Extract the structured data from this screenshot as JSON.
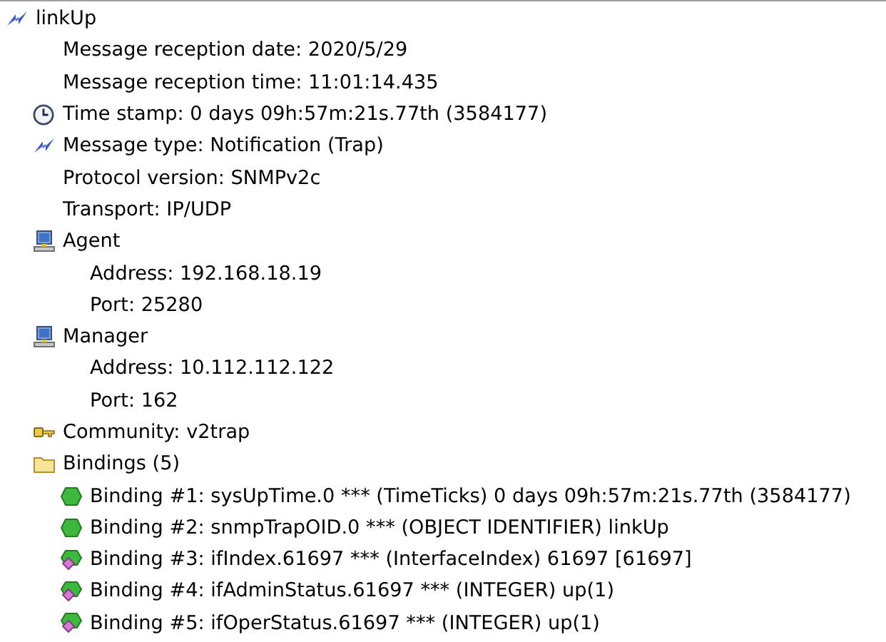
{
  "tree": [
    {
      "label": "linkUp",
      "kind": "trap",
      "children": [
        {
          "label": "Message reception date: 2020/5/29",
          "kind": "plain"
        },
        {
          "label": "Message reception time: 11:01:14.435",
          "kind": "plain"
        },
        {
          "label": "Time stamp: 0 days 09h:57m:21s.77th (3584177)",
          "kind": "time"
        },
        {
          "label": "Message type: Notification (Trap)",
          "kind": "trap"
        },
        {
          "label": "Protocol version: SNMPv2c",
          "kind": "plain"
        },
        {
          "label": "Transport: IP/UDP",
          "kind": "plain"
        },
        {
          "label": "Agent",
          "kind": "host",
          "children": [
            {
              "label": "Address: 192.168.18.19",
              "kind": "plain"
            },
            {
              "label": "Port: 25280",
              "kind": "plain"
            }
          ]
        },
        {
          "label": "Manager",
          "kind": "host",
          "children": [
            {
              "label": "Address: 10.112.112.122",
              "kind": "plain"
            },
            {
              "label": "Port: 162",
              "kind": "plain"
            }
          ]
        },
        {
          "label": "Community: v2trap",
          "kind": "community"
        },
        {
          "label": "Bindings (5)",
          "kind": "group",
          "children": [
            {
              "label": "Binding #1: sysUpTime.0 *** (TimeTicks) 0 days 09h:57m:21s.77th (3584177)",
              "kind": "binding"
            },
            {
              "label": "Binding #2: snmpTrapOID.0 *** (OBJECT IDENTIFIER) linkUp",
              "kind": "binding"
            },
            {
              "label": "Binding #3: ifIndex.61697 *** (InterfaceIndex) 61697 [61697]",
              "kind": "value"
            },
            {
              "label": "Binding #4: ifAdminStatus.61697 *** (INTEGER) up(1)",
              "kind": "value"
            },
            {
              "label": "Binding #5: ifOperStatus.61697 *** (INTEGER) up(1)",
              "kind": "value"
            }
          ]
        }
      ]
    }
  ]
}
